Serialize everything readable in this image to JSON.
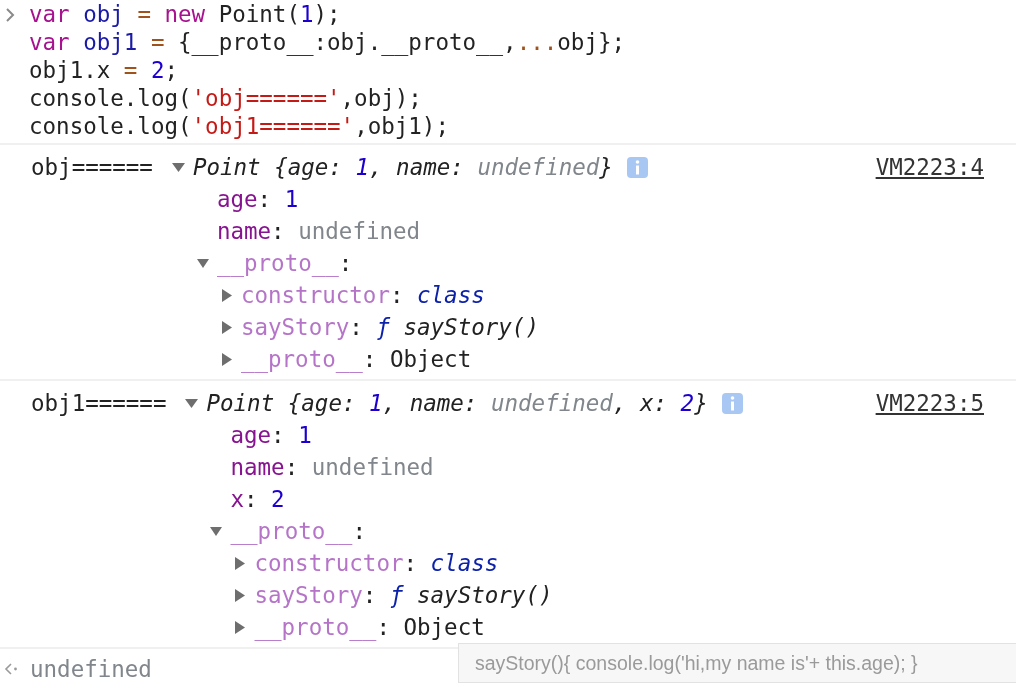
{
  "input": {
    "lines": [
      [
        {
          "text": "var ",
          "kind": "keyword"
        },
        {
          "text": "obj ",
          "kind": "variable"
        },
        {
          "text": "= ",
          "kind": "operator"
        },
        {
          "text": "new ",
          "kind": "keyword"
        },
        {
          "text": "Point(",
          "kind": "plain"
        },
        {
          "text": "1",
          "kind": "number"
        },
        {
          "text": ");",
          "kind": "plain"
        }
      ],
      [
        {
          "text": "var ",
          "kind": "keyword"
        },
        {
          "text": "obj1 ",
          "kind": "variable"
        },
        {
          "text": "=",
          "kind": "operator"
        },
        {
          "text": " {__proto__:obj.__proto__,",
          "kind": "plain"
        },
        {
          "text": "...",
          "kind": "operator"
        },
        {
          "text": "obj};",
          "kind": "plain"
        }
      ],
      [
        {
          "text": "obj1.x ",
          "kind": "plain"
        },
        {
          "text": "= ",
          "kind": "operator"
        },
        {
          "text": "2",
          "kind": "number"
        },
        {
          "text": ";",
          "kind": "plain"
        }
      ],
      [
        {
          "text": "console.log(",
          "kind": "plain"
        },
        {
          "text": "'obj======'",
          "kind": "string"
        },
        {
          "text": ",obj);",
          "kind": "plain"
        }
      ],
      [
        {
          "text": "console.log(",
          "kind": "plain"
        },
        {
          "text": "'obj1======'",
          "kind": "string"
        },
        {
          "text": ",obj1);",
          "kind": "plain"
        }
      ]
    ]
  },
  "entries": [
    {
      "label": "obj======",
      "source": "VM2223:4",
      "expanded": true,
      "summary": [
        {
          "text": "Point {age: ",
          "kind": "plain"
        },
        {
          "text": "1",
          "kind": "number"
        },
        {
          "text": ", name: ",
          "kind": "plain"
        },
        {
          "text": "undefined",
          "kind": "undefined"
        },
        {
          "text": "}",
          "kind": "plain"
        }
      ],
      "properties": [
        {
          "name": "age",
          "own": true,
          "value": [
            {
              "text": ": ",
              "kind": "plain"
            },
            {
              "text": "1",
              "kind": "number"
            }
          ]
        },
        {
          "name": "name",
          "own": true,
          "value": [
            {
              "text": ": ",
              "kind": "plain"
            },
            {
              "text": "undefined",
              "kind": "undefined"
            }
          ]
        },
        {
          "name": "__proto__",
          "own": false,
          "expanded": true,
          "value": [
            {
              "text": ":",
              "kind": "plain"
            }
          ],
          "children": [
            {
              "name": "constructor",
              "own": false,
              "expanded": false,
              "value": [
                {
                  "text": ": ",
                  "kind": "plain"
                },
                {
                  "text": "class",
                  "kind": "class"
                }
              ]
            },
            {
              "name": "sayStory",
              "own": false,
              "expanded": false,
              "value": [
                {
                  "text": ": ",
                  "kind": "plain"
                },
                {
                  "text": "ƒ",
                  "kind": "fn"
                },
                {
                  "text": " sayStory()",
                  "kind": "fnname"
                }
              ]
            },
            {
              "name": "__proto__",
              "own": false,
              "expanded": false,
              "value": [
                {
                  "text": ": ",
                  "kind": "plain"
                },
                {
                  "text": "Object",
                  "kind": "plain"
                }
              ]
            }
          ]
        }
      ]
    },
    {
      "label": "obj1======",
      "source": "VM2223:5",
      "expanded": true,
      "summary": [
        {
          "text": "Point {age: ",
          "kind": "plain"
        },
        {
          "text": "1",
          "kind": "number"
        },
        {
          "text": ", name: ",
          "kind": "plain"
        },
        {
          "text": "undefined",
          "kind": "undefined"
        },
        {
          "text": ", x: ",
          "kind": "plain"
        },
        {
          "text": "2",
          "kind": "number"
        },
        {
          "text": "}",
          "kind": "plain"
        }
      ],
      "properties": [
        {
          "name": "age",
          "own": true,
          "value": [
            {
              "text": ": ",
              "kind": "plain"
            },
            {
              "text": "1",
              "kind": "number"
            }
          ]
        },
        {
          "name": "name",
          "own": true,
          "value": [
            {
              "text": ": ",
              "kind": "plain"
            },
            {
              "text": "undefined",
              "kind": "undefined"
            }
          ]
        },
        {
          "name": "x",
          "own": true,
          "value": [
            {
              "text": ": ",
              "kind": "plain"
            },
            {
              "text": "2",
              "kind": "number"
            }
          ]
        },
        {
          "name": "__proto__",
          "own": false,
          "expanded": true,
          "value": [
            {
              "text": ":",
              "kind": "plain"
            }
          ],
          "children": [
            {
              "name": "constructor",
              "own": false,
              "expanded": false,
              "value": [
                {
                  "text": ": ",
                  "kind": "plain"
                },
                {
                  "text": "class",
                  "kind": "class"
                }
              ]
            },
            {
              "name": "sayStory",
              "own": false,
              "expanded": false,
              "value": [
                {
                  "text": ": ",
                  "kind": "plain"
                },
                {
                  "text": "ƒ",
                  "kind": "fn"
                },
                {
                  "text": " sayStory()",
                  "kind": "fnname"
                }
              ]
            },
            {
              "name": "__proto__",
              "own": false,
              "expanded": false,
              "value": [
                {
                  "text": ": ",
                  "kind": "plain"
                },
                {
                  "text": "Object",
                  "kind": "plain"
                }
              ]
            }
          ]
        }
      ]
    }
  ],
  "tooltip": {
    "text": "sayStory(){ console.log('hi,my name is'+ this.age); }"
  },
  "result": {
    "text": "undefined"
  }
}
